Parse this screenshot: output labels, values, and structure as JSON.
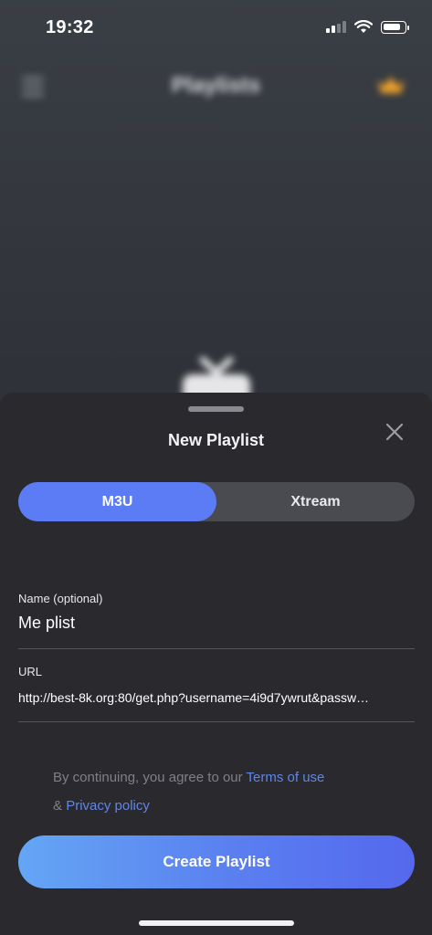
{
  "status_bar": {
    "time": "19:32",
    "battery_level": 0.85
  },
  "background": {
    "title": "Playlists",
    "menu_icon": "hamburger-icon",
    "premium_icon": "crown-icon",
    "placeholder_icon": "tv-icon"
  },
  "sheet": {
    "title": "New Playlist",
    "close_icon": "close-icon",
    "tabs": [
      {
        "label": "M3U",
        "active": true
      },
      {
        "label": "Xtream",
        "active": false
      }
    ],
    "name_field": {
      "label": "Name (optional)",
      "value": "Me plist"
    },
    "url_field": {
      "label": "URL",
      "value": "http://best-8k.org:80/get.php?username=4i9d7ywrut&passw…"
    },
    "legal": {
      "prefix": "By continuing, you agree to our ",
      "terms_link": "Terms of use",
      "amp": "& ",
      "privacy_link": "Privacy policy"
    },
    "create_button": "Create Playlist"
  },
  "colors": {
    "accent": "#5b7cf5",
    "link": "#5f86e8",
    "sheet_bg": "#29292e"
  }
}
